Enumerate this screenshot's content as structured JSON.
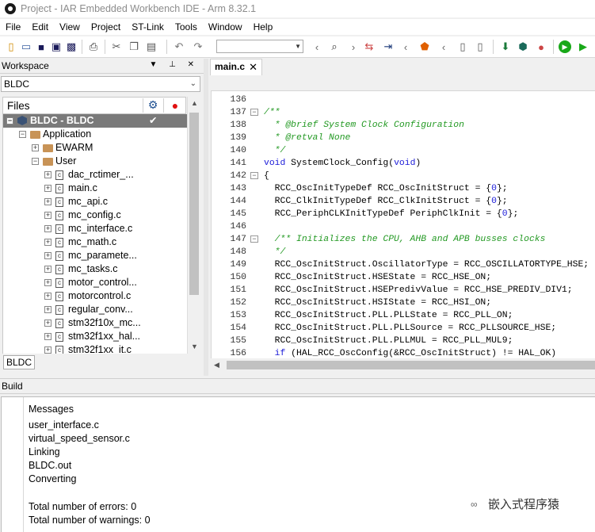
{
  "window": {
    "title": "Project - IAR Embedded Workbench IDE - Arm 8.32.1"
  },
  "menu": [
    "File",
    "Edit",
    "View",
    "Project",
    "ST-Link",
    "Tools",
    "Window",
    "Help"
  ],
  "workspace": {
    "title": "Workspace",
    "controls": "▼ ⊥ ✕",
    "config": "BLDC",
    "files_label": "Files",
    "bottom_tab": "BLDC",
    "tree": [
      {
        "label": "BLDC - BLDC",
        "kind": "project",
        "level": 0,
        "check": "✔"
      },
      {
        "label": "Application",
        "kind": "folder",
        "level": 1
      },
      {
        "label": "EWARM",
        "kind": "folder",
        "level": 2
      },
      {
        "label": "User",
        "kind": "folder",
        "level": 2
      },
      {
        "label": "dac_rctimer_...",
        "kind": "file",
        "level": 3
      },
      {
        "label": "main.c",
        "kind": "file",
        "level": 3
      },
      {
        "label": "mc_api.c",
        "kind": "file",
        "level": 3
      },
      {
        "label": "mc_config.c",
        "kind": "file",
        "level": 3
      },
      {
        "label": "mc_interface.c",
        "kind": "file",
        "level": 3
      },
      {
        "label": "mc_math.c",
        "kind": "file",
        "level": 3
      },
      {
        "label": "mc_paramete...",
        "kind": "file",
        "level": 3
      },
      {
        "label": "mc_tasks.c",
        "kind": "file",
        "level": 3
      },
      {
        "label": "motor_control...",
        "kind": "file",
        "level": 3
      },
      {
        "label": "motorcontrol.c",
        "kind": "file",
        "level": 3
      },
      {
        "label": "regular_conv...",
        "kind": "file",
        "level": 3
      },
      {
        "label": "stm32f10x_mc...",
        "kind": "file",
        "level": 3
      },
      {
        "label": "stm32f1xx_hal...",
        "kind": "file",
        "level": 3
      },
      {
        "label": "stm32f1xx_it.c",
        "kind": "file",
        "level": 3
      }
    ]
  },
  "editor": {
    "tab": "main.c",
    "close": "✕",
    "lines": [
      {
        "n": "136",
        "fold": "",
        "parts": [
          {
            "t": "",
            "c": ""
          }
        ]
      },
      {
        "n": "137",
        "fold": "−",
        "parts": [
          {
            "t": "/**",
            "c": "cmt"
          }
        ]
      },
      {
        "n": "138",
        "fold": "",
        "parts": [
          {
            "t": "  * @brief System Clock Configuration",
            "c": "cmt"
          }
        ]
      },
      {
        "n": "139",
        "fold": "",
        "parts": [
          {
            "t": "  * @retval None",
            "c": "cmt"
          }
        ]
      },
      {
        "n": "140",
        "fold": "",
        "parts": [
          {
            "t": "  */",
            "c": "cmt"
          }
        ]
      },
      {
        "n": "141",
        "fold": "",
        "parts": [
          {
            "t": "void",
            "c": "kw"
          },
          {
            "t": " SystemClock_Config(",
            "c": ""
          },
          {
            "t": "void",
            "c": "kw"
          },
          {
            "t": ")",
            "c": ""
          }
        ]
      },
      {
        "n": "142",
        "fold": "−",
        "parts": [
          {
            "t": "{",
            "c": ""
          }
        ]
      },
      {
        "n": "143",
        "fold": "",
        "parts": [
          {
            "t": "  RCC_OscInitTypeDef RCC_OscInitStruct = {",
            "c": ""
          },
          {
            "t": "0",
            "c": "num"
          },
          {
            "t": "};",
            "c": ""
          }
        ]
      },
      {
        "n": "144",
        "fold": "",
        "parts": [
          {
            "t": "  RCC_ClkInitTypeDef RCC_ClkInitStruct = {",
            "c": ""
          },
          {
            "t": "0",
            "c": "num"
          },
          {
            "t": "};",
            "c": ""
          }
        ]
      },
      {
        "n": "145",
        "fold": "",
        "parts": [
          {
            "t": "  RCC_PeriphCLKInitTypeDef PeriphClkInit = {",
            "c": ""
          },
          {
            "t": "0",
            "c": "num"
          },
          {
            "t": "};",
            "c": ""
          }
        ]
      },
      {
        "n": "146",
        "fold": "",
        "parts": [
          {
            "t": "",
            "c": ""
          }
        ]
      },
      {
        "n": "147",
        "fold": "−",
        "parts": [
          {
            "t": "  /** Initializes the CPU, AHB and APB busses clocks",
            "c": "cmt"
          }
        ]
      },
      {
        "n": "148",
        "fold": "",
        "parts": [
          {
            "t": "  */",
            "c": "cmt"
          }
        ]
      },
      {
        "n": "149",
        "fold": "",
        "parts": [
          {
            "t": "  RCC_OscInitStruct.OscillatorType = RCC_OSCILLATORTYPE_HSE;",
            "c": ""
          }
        ]
      },
      {
        "n": "150",
        "fold": "",
        "parts": [
          {
            "t": "  RCC_OscInitStruct.HSEState = RCC_HSE_ON;",
            "c": ""
          }
        ]
      },
      {
        "n": "151",
        "fold": "",
        "parts": [
          {
            "t": "  RCC_OscInitStruct.HSEPredivValue = RCC_HSE_PREDIV_DIV1;",
            "c": ""
          }
        ]
      },
      {
        "n": "152",
        "fold": "",
        "parts": [
          {
            "t": "  RCC_OscInitStruct.HSIState = RCC_HSI_ON;",
            "c": ""
          }
        ]
      },
      {
        "n": "153",
        "fold": "",
        "parts": [
          {
            "t": "  RCC_OscInitStruct.PLL.PLLState = RCC_PLL_ON;",
            "c": ""
          }
        ]
      },
      {
        "n": "154",
        "fold": "",
        "parts": [
          {
            "t": "  RCC_OscInitStruct.PLL.PLLSource = RCC_PLLSOURCE_HSE;",
            "c": ""
          }
        ]
      },
      {
        "n": "155",
        "fold": "",
        "parts": [
          {
            "t": "  RCC_OscInitStruct.PLL.PLLMUL = RCC_PLL_MUL9;",
            "c": ""
          }
        ]
      },
      {
        "n": "156",
        "fold": "",
        "parts": [
          {
            "t": "  ",
            "c": ""
          },
          {
            "t": "if",
            "c": "kw"
          },
          {
            "t": " (HAL_RCC_OscConfig(&RCC_OscInitStruct) != HAL_OK)",
            "c": ""
          }
        ]
      }
    ]
  },
  "build": {
    "title": "Build",
    "messages_header": "Messages",
    "messages": [
      "user_interface.c",
      "virtual_speed_sensor.c",
      "Linking",
      "BLDC.out",
      "Converting",
      "",
      "Total number of errors: 0",
      "Total number of warnings: 0"
    ]
  },
  "watermark": "嵌入式程序猿",
  "colors": {
    "comment": "#239923",
    "keyword": "#1b1bd8",
    "selected_row": "#7a7a7a",
    "folder": "#c89356"
  }
}
